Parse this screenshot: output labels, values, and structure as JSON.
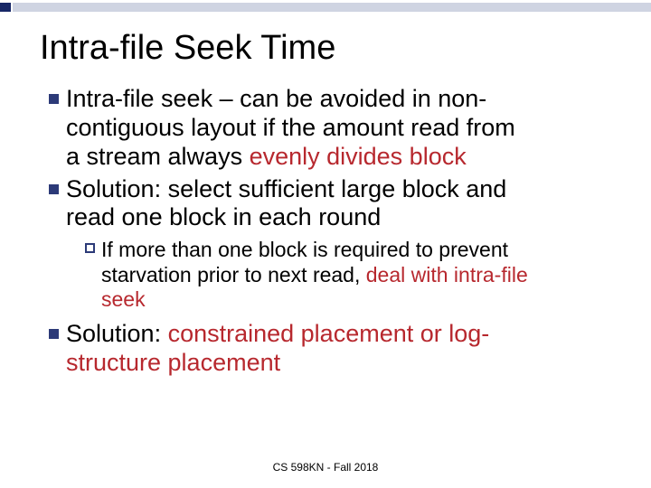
{
  "title": "Intra-file Seek Time",
  "bullets": {
    "b1": {
      "t1": "Intra-file seek – can be avoided in non-",
      "t2": "contiguous layout if the amount read from",
      "t3": "a stream always ",
      "t3r": "evenly divides block"
    },
    "b2": {
      "t1": "Solution: select sufficient large block and",
      "t2": "read one block in each round"
    },
    "sub1": {
      "t1": "If more than one block is required to prevent",
      "t2a": "starvation prior to next read, ",
      "t2r": "deal with intra-file",
      "t3r": "seek"
    },
    "b3": {
      "t1a": "Solution: ",
      "t1r": "constrained placement or log-",
      "t2r": "structure placement"
    }
  },
  "footer": "CS 598KN - Fall 2018"
}
